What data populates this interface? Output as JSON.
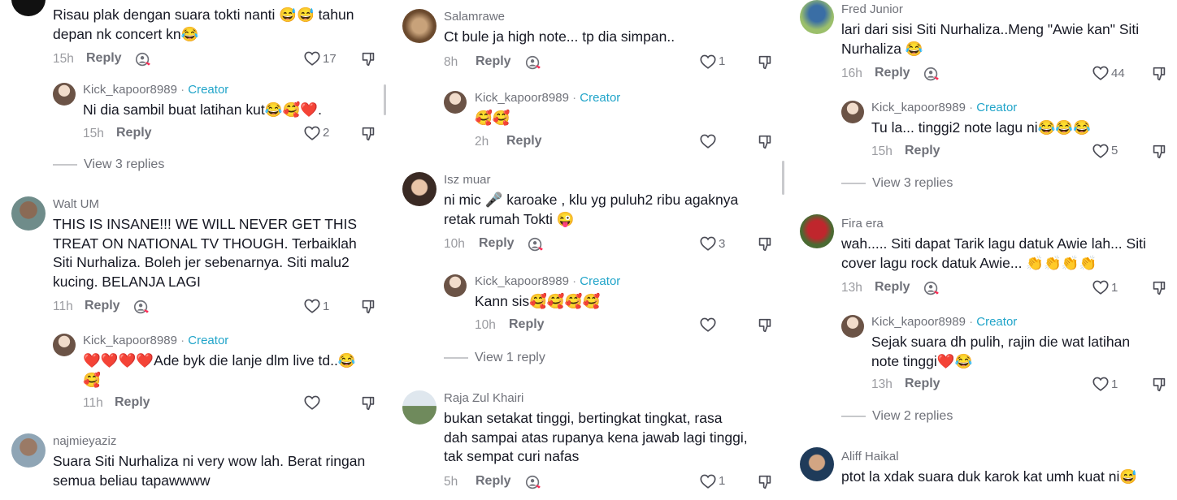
{
  "col1": {
    "c1": {
      "text": "Risau plak dengan suara tokti nanti 😅😅 tahun",
      "text2": "depan nk concert kn😂",
      "time": "15h",
      "reply": "Reply",
      "likes": "17"
    },
    "r1": {
      "name": "Kick_kapoor8989",
      "sep": " · ",
      "creator": "Creator",
      "text": "Ni dia sambil buat latihan kut😂🥰❤️.",
      "time": "15h",
      "reply": "Reply",
      "likes": "2"
    },
    "v1": "View 3 replies",
    "c2": {
      "name": "Walt UM",
      "t1": "THIS IS INSANE!!! WE WILL NEVER GET THIS",
      "t2": "TREAT ON NATIONAL TV THOUGH. Terbaiklah",
      "t3": "Siti Nurhaliza. Boleh jer sebenarnya. Siti malu2",
      "t4": "kucing. BELANJA LAGI",
      "time": "11h",
      "reply": "Reply",
      "likes": "1"
    },
    "r2": {
      "name": "Kick_kapoor8989",
      "sep": " · ",
      "creator": "Creator",
      "t1": "❤️❤️❤️❤️Ade byk die lanje dlm live td..😂",
      "t2": "🥰",
      "time": "11h",
      "reply": "Reply"
    },
    "c3": {
      "name": "najmieyaziz",
      "t1": "Suara Siti Nurhaliza ni very wow lah. Berat ringan",
      "t2": "semua beliau tapawwww"
    }
  },
  "col2": {
    "c1": {
      "name": "Salamrawe",
      "text": "Ct bule ja high note... tp dia simpan..",
      "time": "8h",
      "reply": "Reply",
      "likes": "1"
    },
    "r1": {
      "name": "Kick_kapoor8989",
      "sep": " · ",
      "creator": "Creator",
      "text": "🥰🥰",
      "time": "2h",
      "reply": "Reply"
    },
    "c2": {
      "name": "Isz muar",
      "t1": "ni mic 🎤 karoake , klu yg puluh2 ribu agaknya",
      "t2": "retak rumah Tokti 😜",
      "time": "10h",
      "reply": "Reply",
      "likes": "3"
    },
    "r2": {
      "name": "Kick_kapoor8989",
      "sep": " · ",
      "creator": "Creator",
      "text": "Kann sis🥰🥰🥰🥰",
      "time": "10h",
      "reply": "Reply"
    },
    "v1": "View 1 reply",
    "c3": {
      "name": "Raja Zul Khairi",
      "t1": "bukan setakat tinggi, bertingkat tingkat, rasa",
      "t2": "dah sampai atas rupanya kena jawab lagi tinggi,",
      "t3": "tak sempat curi nafas",
      "time": "5h",
      "reply": "Reply",
      "likes": "1"
    }
  },
  "col3": {
    "c1": {
      "name": "Fred Junior",
      "t1": "lari dari sisi Siti Nurhaliza..Meng \"Awie kan\" Siti",
      "t2": "Nurhaliza 😂",
      "time": "16h",
      "reply": "Reply",
      "likes": "44"
    },
    "r1": {
      "name": "Kick_kapoor8989",
      "sep": " · ",
      "creator": "Creator",
      "text": "Tu la... tinggi2 note lagu ni😂😂😂",
      "time": "15h",
      "reply": "Reply",
      "likes": "5"
    },
    "v1": "View 3 replies",
    "c2": {
      "name": "Fira era",
      "t1": "wah..... Siti dapat Tarik lagu datuk Awie lah... Siti",
      "t2": "cover lagu rock datuk Awie... 👏👏👏👏",
      "time": "13h",
      "reply": "Reply",
      "likes": "1"
    },
    "r2": {
      "name": "Kick_kapoor8989",
      "sep": " · ",
      "creator": "Creator",
      "t1": "Sejak suara dh pulih, rajin die wat latihan",
      "t2": "note tinggi❤️😂",
      "time": "13h",
      "reply": "Reply",
      "likes": "1"
    },
    "v2": "View 2 replies",
    "c3": {
      "name": "Aliff Haikal",
      "t1": "ptot la xdak suara duk karok kat umh kuat ni😅"
    }
  }
}
